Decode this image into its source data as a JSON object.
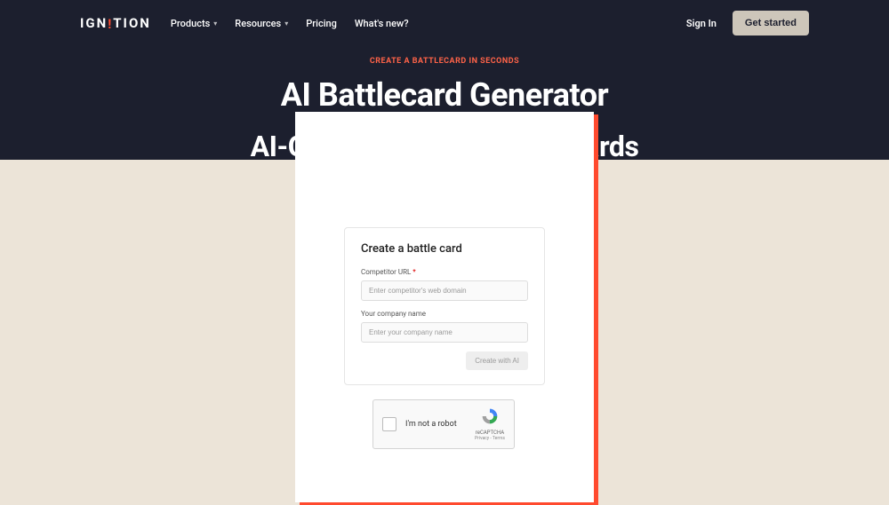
{
  "header": {
    "logo_prefix": "IGN",
    "logo_exclaim": "!",
    "logo_suffix": "TION",
    "nav": {
      "products": "Products",
      "resources": "Resources",
      "pricing": "Pricing",
      "whatsnew": "What's new?"
    },
    "sign_in": "Sign In",
    "get_started": "Get started"
  },
  "hero": {
    "eyebrow_1": "CREATE A BATTLECARD",
    "eyebrow_2": " IN SECONDS",
    "title": "AI Battlecard Generator",
    "subtitle": "AI-Generated Sales Battlecards"
  },
  "form": {
    "title": "Create a battle card",
    "competitor_label": "Competitor URL",
    "competitor_required": "*",
    "competitor_placeholder": "Enter competitor's web domain",
    "company_label": "Your company name",
    "company_placeholder": "Enter your company name",
    "submit": "Create with AI"
  },
  "recaptcha": {
    "label": "I'm not a robot",
    "brand": "reCAPTCHA",
    "terms": "Privacy - Terms"
  }
}
